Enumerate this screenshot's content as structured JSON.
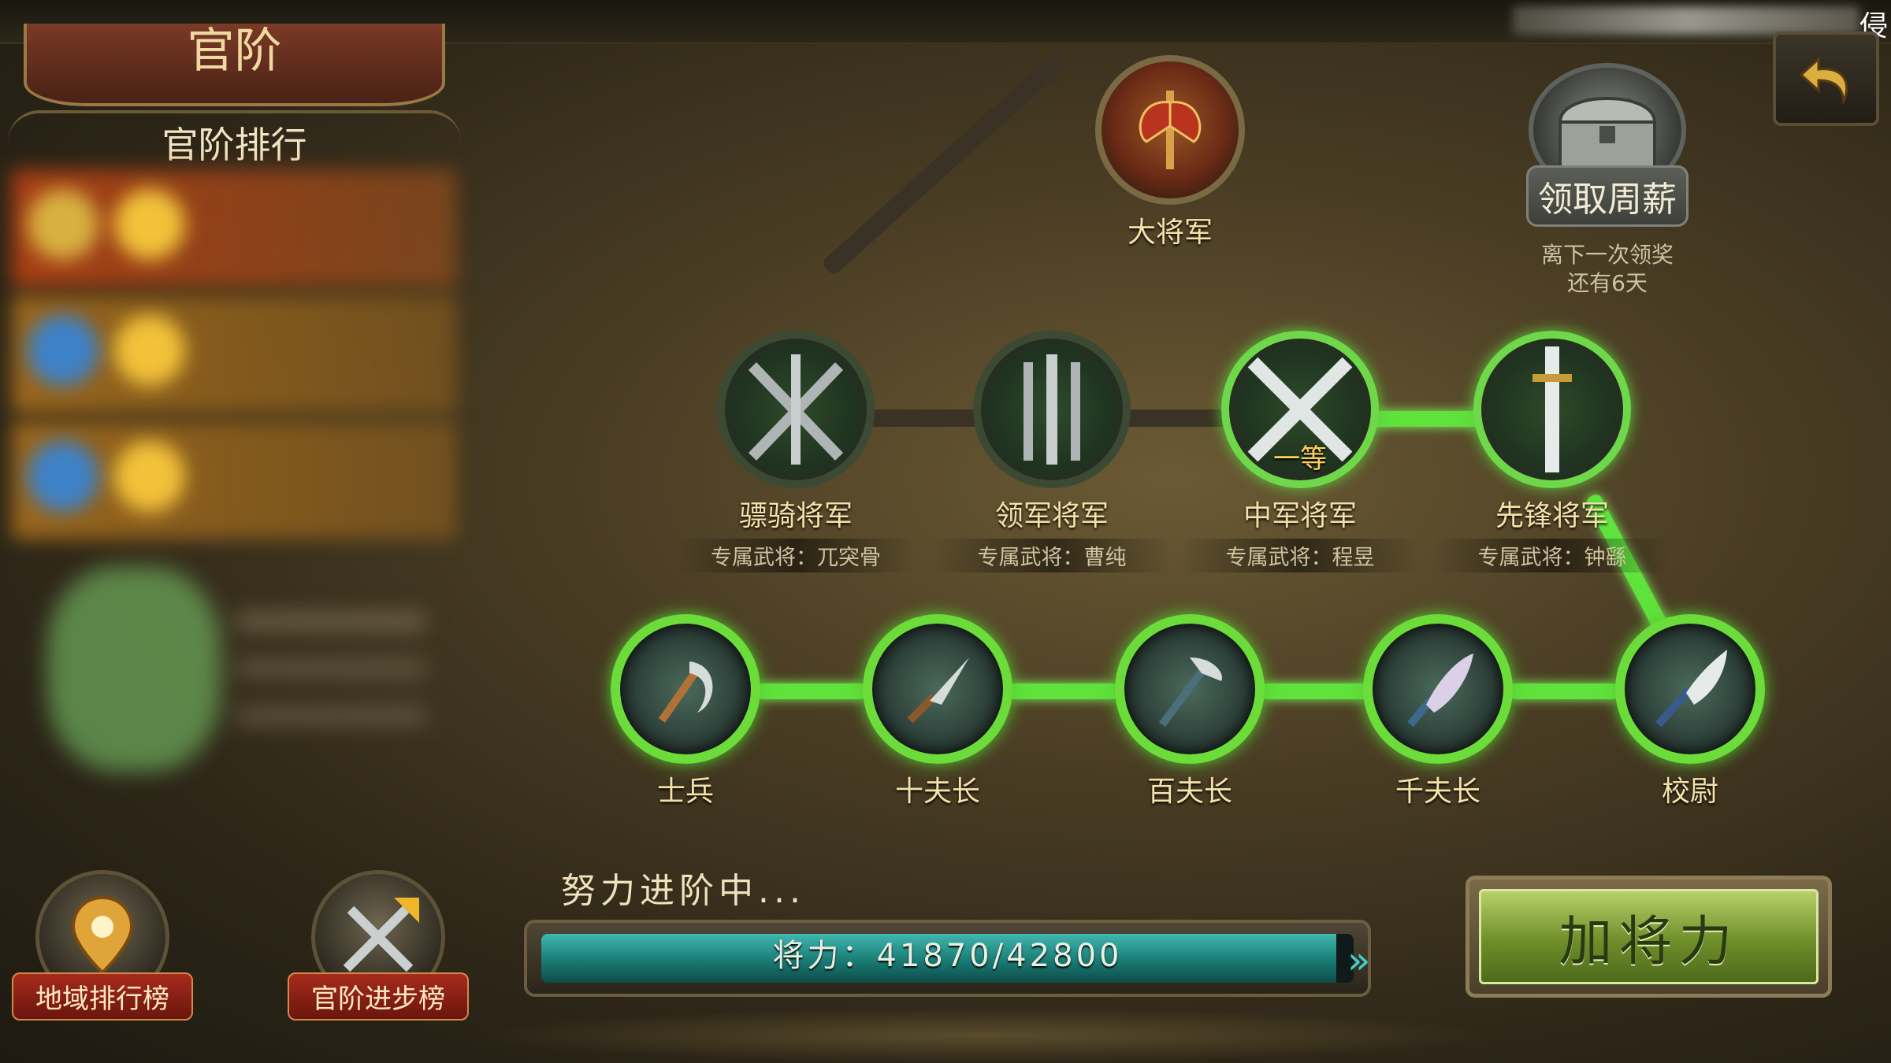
{
  "header": {
    "title": "官阶",
    "corner_text": "侵"
  },
  "ranking": {
    "title": "官阶排行"
  },
  "bottom_buttons": [
    {
      "label": "地域排行榜",
      "icon": "map-pin-icon"
    },
    {
      "label": "官阶进步榜",
      "icon": "crossed-swords-arrow-icon"
    }
  ],
  "top_node": {
    "name": "大将军",
    "icon": "axe-emblem-icon"
  },
  "generals": [
    {
      "name": "骠骑将军",
      "sub": "专属武将：兀突骨",
      "icon": "crossed-swords-icon"
    },
    {
      "name": "领军将军",
      "sub": "专属武将：曹纯",
      "icon": "triple-swords-icon"
    },
    {
      "name": "中军将军",
      "sub": "专属武将：程昱",
      "tag": "一等",
      "icon": "crossed-swords-icon"
    },
    {
      "name": "先锋将军",
      "sub": "专属武将：钟繇",
      "icon": "single-sword-icon"
    }
  ],
  "ranks": [
    {
      "name": "士兵",
      "icon": "sickle-icon"
    },
    {
      "name": "十夫长",
      "icon": "dagger-icon"
    },
    {
      "name": "百夫长",
      "icon": "halberd-icon"
    },
    {
      "name": "千夫长",
      "icon": "broadsword-icon"
    },
    {
      "name": "校尉",
      "icon": "guandao-icon"
    }
  ],
  "reward": {
    "label": "领取周薪",
    "note_line1": "离下一次领奖",
    "note_line2": "还有6天"
  },
  "progress": {
    "status": "努力进阶中...",
    "text": "将力：41870/42800",
    "current": 41870,
    "max": 42800
  },
  "action": {
    "label": "加将力"
  },
  "colors": {
    "lit_path": "#5fe23c",
    "bar_fill": "#187670",
    "button_green": "#6e8e2a"
  }
}
